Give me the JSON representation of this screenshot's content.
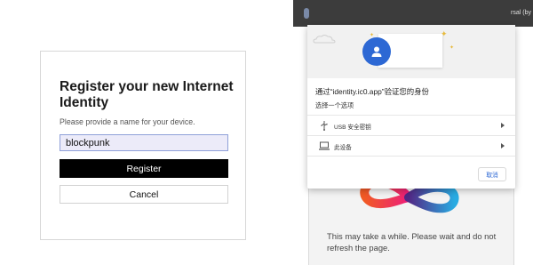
{
  "register": {
    "title": "Register your new Internet Identity",
    "subtitle": "Please provide a name for your device.",
    "device_name_value": "blockpunk",
    "register_label": "Register",
    "cancel_label": "Cancel"
  },
  "browser": {
    "tab_fragment": "rsal (by"
  },
  "dialog": {
    "title": "通过“identity.ic0.app”验证您的身份",
    "subtitle": "选择一个选项",
    "options": [
      {
        "icon": "usb-icon",
        "label": "USB 安全密钥"
      },
      {
        "icon": "laptop-icon",
        "label": "此设备"
      }
    ],
    "cancel_label": "取消"
  },
  "page": {
    "loading_text": "This may take a while. Please wait and do not refresh the page."
  },
  "colors": {
    "accent_blue": "#2d68d4",
    "input_bg": "#ecebf9",
    "button_black": "#000000"
  }
}
